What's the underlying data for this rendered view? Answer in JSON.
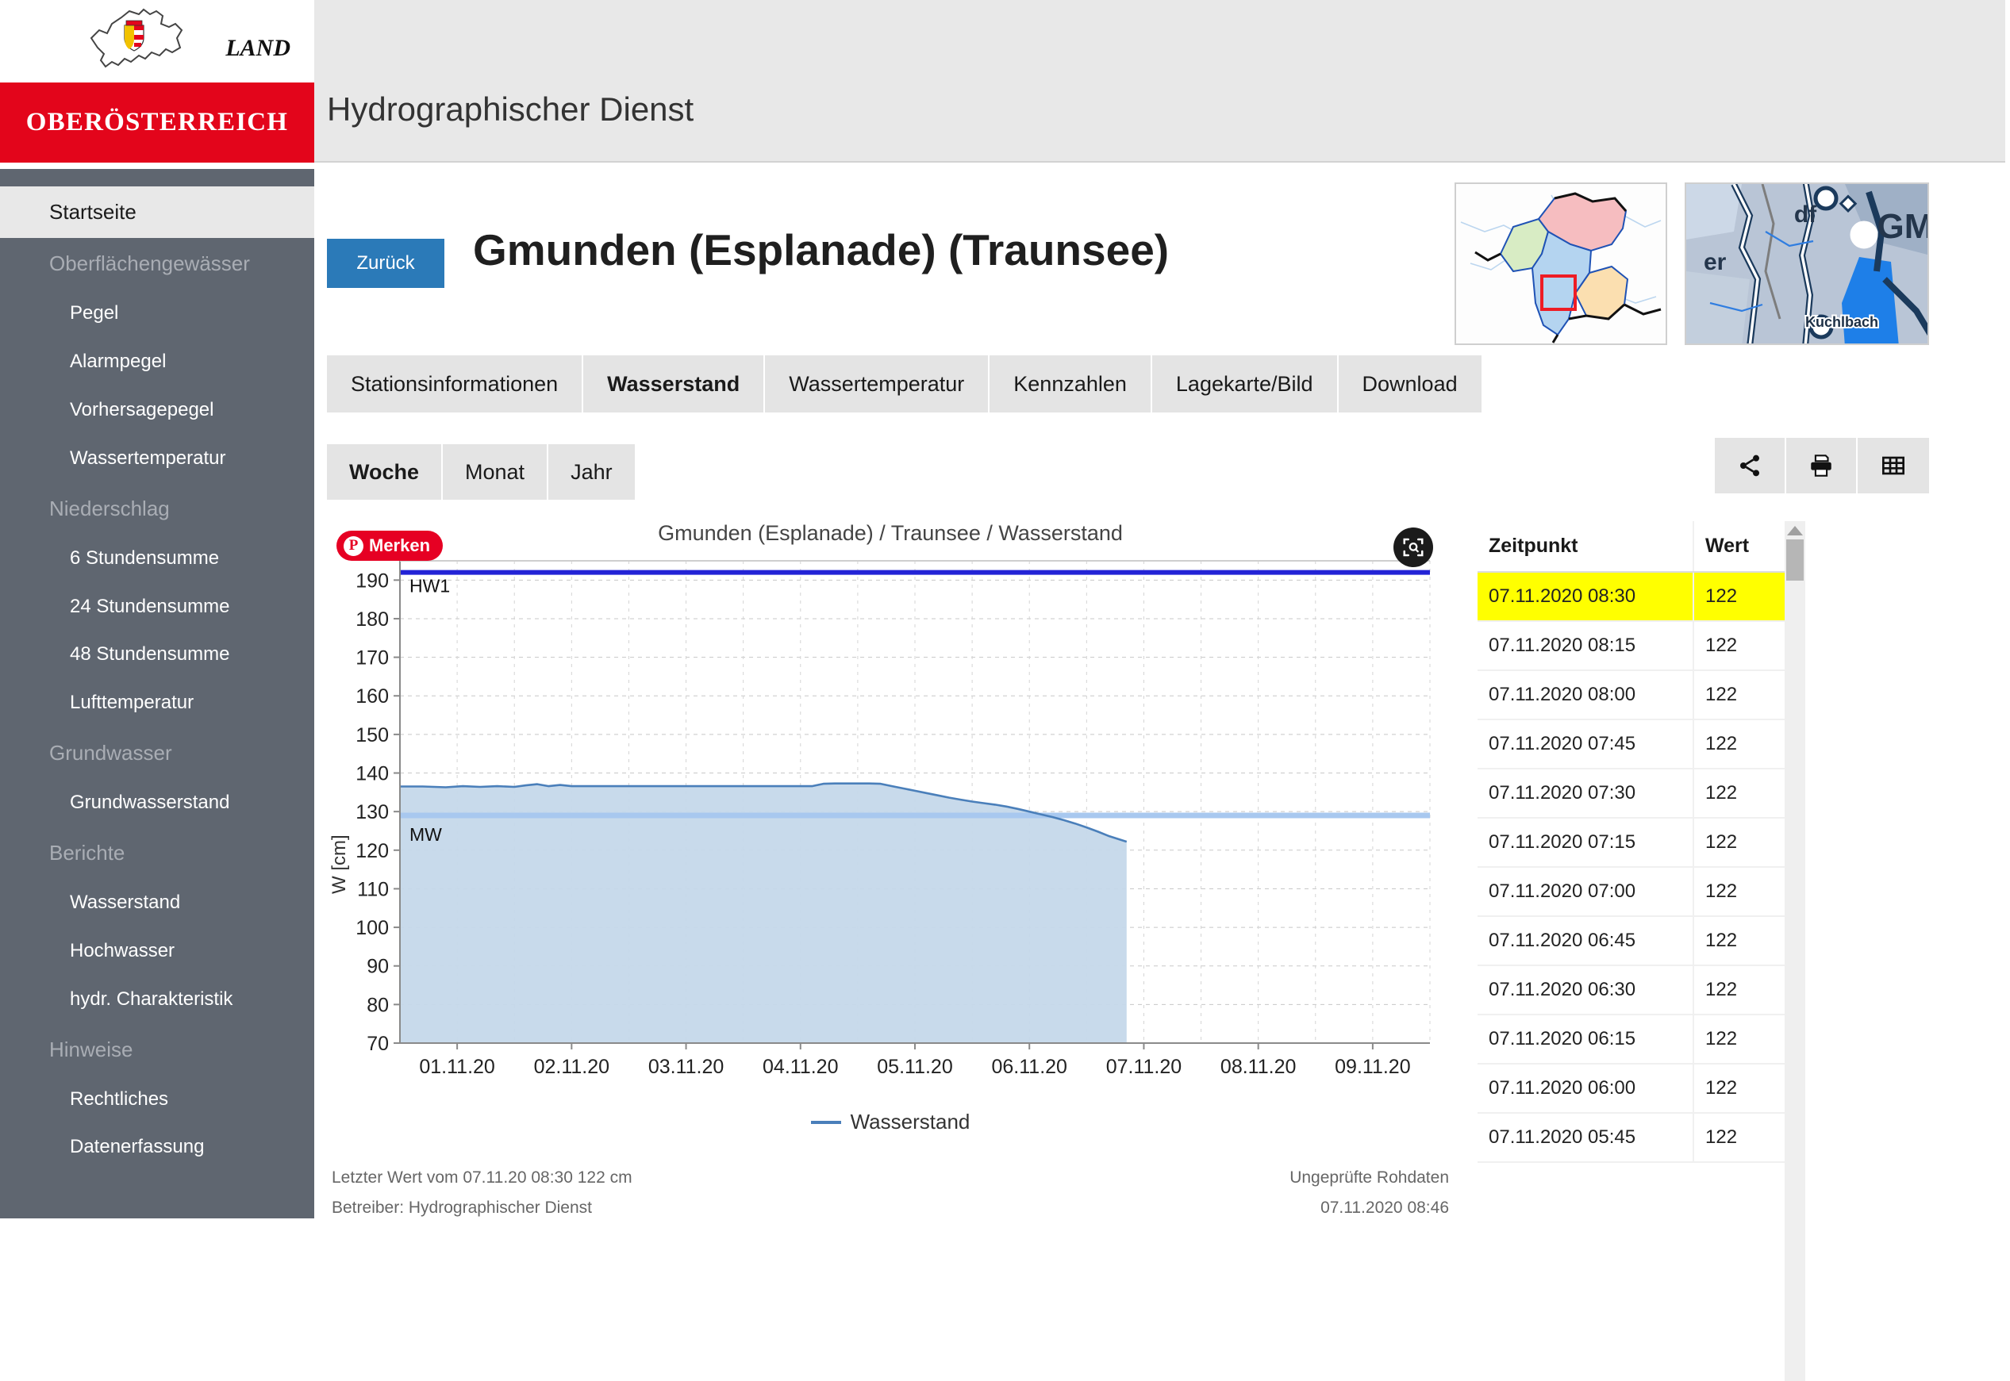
{
  "brand": {
    "land_label": "LAND",
    "state_label": "OBERÖSTERREICH"
  },
  "header": {
    "title": "Hydrographischer Dienst"
  },
  "sidebar": {
    "home_label": "Startseite",
    "entries": [
      {
        "type": "group",
        "label": "Oberflächengewässer"
      },
      {
        "type": "item",
        "label": "Pegel"
      },
      {
        "type": "item",
        "label": "Alarmpegel"
      },
      {
        "type": "item",
        "label": "Vorhersagepegel"
      },
      {
        "type": "item",
        "label": "Wassertemperatur"
      },
      {
        "type": "group",
        "label": "Niederschlag"
      },
      {
        "type": "item",
        "label": "6 Stundensumme"
      },
      {
        "type": "item",
        "label": "24 Stundensumme"
      },
      {
        "type": "item",
        "label": "48 Stundensumme"
      },
      {
        "type": "item",
        "label": "Lufttemperatur"
      },
      {
        "type": "group",
        "label": "Grundwasser"
      },
      {
        "type": "item",
        "label": "Grundwasserstand"
      },
      {
        "type": "group",
        "label": "Berichte"
      },
      {
        "type": "item",
        "label": "Wasserstand"
      },
      {
        "type": "item",
        "label": "Hochwasser"
      },
      {
        "type": "item",
        "label": "hydr. Charakteristik"
      },
      {
        "type": "group",
        "label": "Hinweise"
      },
      {
        "type": "item",
        "label": "Rechtliches"
      },
      {
        "type": "item",
        "label": "Datenerfassung"
      }
    ]
  },
  "page": {
    "back_label": "Zurück",
    "title": "Gmunden (Esplanade) (Traunsee)"
  },
  "tabs": [
    {
      "label": "Stationsinformationen",
      "active": false
    },
    {
      "label": "Wasserstand",
      "active": true
    },
    {
      "label": "Wassertemperatur",
      "active": false
    },
    {
      "label": "Kennzahlen",
      "active": false
    },
    {
      "label": "Lagekarte/Bild",
      "active": false
    },
    {
      "label": "Download",
      "active": false
    }
  ],
  "periods": [
    {
      "label": "Woche",
      "active": true
    },
    {
      "label": "Monat",
      "active": false
    },
    {
      "label": "Jahr",
      "active": false
    }
  ],
  "toolbar": {
    "share_label": "share-icon",
    "print_label": "print-icon",
    "table_label": "table-icon"
  },
  "chart_overlays": {
    "pin_label": "Merken",
    "pin_glyph": "P",
    "zoom_label": "zoom-icon"
  },
  "chart_data": {
    "type": "area",
    "title": "Gmunden (Esplanade) / Traunsee / Wasserstand",
    "xlabel": "",
    "ylabel": "W [cm]",
    "ylim": [
      70,
      195
    ],
    "yticks": [
      70,
      80,
      90,
      100,
      110,
      120,
      130,
      140,
      150,
      160,
      170,
      180,
      190
    ],
    "xticks": [
      "01.11.20",
      "02.11.20",
      "03.11.20",
      "04.11.20",
      "05.11.20",
      "06.11.20",
      "07.11.20",
      "08.11.20",
      "09.11.20"
    ],
    "grid": true,
    "legend": [
      {
        "name": "Wasserstand",
        "color": "#4a7fba"
      }
    ],
    "legend_position": "bottom",
    "reference_lines": [
      {
        "label": "HW1",
        "value": 192,
        "color": "#2323d6"
      },
      {
        "label": "MW",
        "value": 129,
        "color": "#a8c8ef"
      }
    ],
    "series": [
      {
        "name": "Wasserstand",
        "color": "#4a7fba",
        "fill": "#c5d8ea",
        "x": [
          0.0,
          0.2,
          0.4,
          0.55,
          0.7,
          0.85,
          1.0,
          1.1,
          1.2,
          1.3,
          1.4,
          1.5,
          1.7,
          1.9,
          2.2,
          2.5,
          2.8,
          3.1,
          3.4,
          3.6,
          3.7,
          3.8,
          3.9,
          4.0,
          4.1,
          4.2,
          4.3,
          4.4,
          4.5,
          4.6,
          4.7,
          4.8,
          4.9,
          5.0,
          5.1,
          5.2,
          5.3,
          5.4,
          5.5,
          5.6,
          5.7,
          5.8,
          5.9,
          6.0,
          6.1,
          6.2,
          6.35
        ],
        "y": [
          136.5,
          136.5,
          136.3,
          136.6,
          136.4,
          136.6,
          136.4,
          136.8,
          137.1,
          136.6,
          136.9,
          136.6,
          136.6,
          136.6,
          136.6,
          136.6,
          136.6,
          136.6,
          136.6,
          136.6,
          137.2,
          137.3,
          137.3,
          137.3,
          137.3,
          137.2,
          136.6,
          136.0,
          135.4,
          134.8,
          134.2,
          133.6,
          133.1,
          132.6,
          132.2,
          131.8,
          131.3,
          130.7,
          130.0,
          129.3,
          128.6,
          127.8,
          126.9,
          125.9,
          124.8,
          123.6,
          122.2
        ]
      }
    ],
    "x_range_days": 9,
    "unit": "cm"
  },
  "chart_footer": {
    "left_1": "Letzter Wert vom 07.11.20 08:30 122 cm",
    "left_2": "Betreiber: Hydrographischer Dienst",
    "right_1": "Ungeprüfte Rohdaten",
    "right_2": "07.11.2020 08:46"
  },
  "table": {
    "columns": [
      "Zeitpunkt",
      "Wert"
    ],
    "rows": [
      {
        "time": "07.11.2020 08:30",
        "value": "122",
        "highlight": true
      },
      {
        "time": "07.11.2020 08:15",
        "value": "122",
        "highlight": false
      },
      {
        "time": "07.11.2020 08:00",
        "value": "122",
        "highlight": false
      },
      {
        "time": "07.11.2020 07:45",
        "value": "122",
        "highlight": false
      },
      {
        "time": "07.11.2020 07:30",
        "value": "122",
        "highlight": false
      },
      {
        "time": "07.11.2020 07:15",
        "value": "122",
        "highlight": false
      },
      {
        "time": "07.11.2020 07:00",
        "value": "122",
        "highlight": false
      },
      {
        "time": "07.11.2020 06:45",
        "value": "122",
        "highlight": false
      },
      {
        "time": "07.11.2020 06:30",
        "value": "122",
        "highlight": false
      },
      {
        "time": "07.11.2020 06:15",
        "value": "122",
        "highlight": false
      },
      {
        "time": "07.11.2020 06:00",
        "value": "122",
        "highlight": false
      },
      {
        "time": "07.11.2020 05:45",
        "value": "122",
        "highlight": false
      }
    ]
  },
  "maps": {
    "overview_label": "upper-austria-overview-map",
    "detail_label": "station-detail-map",
    "detail_water_label": "Kuchlbach",
    "detail_place_label": "GM",
    "detail_place_label_2": "df",
    "detail_place_label_3": "er"
  },
  "colors": {
    "brand_red": "#e3051b",
    "sidebar": "#5f6670",
    "accent_blue": "#2b7ab8",
    "series": "#4a7fba",
    "fill": "#c5d8ea",
    "hw1": "#2323d6",
    "mw": "#a8c8ef",
    "highlight": "#ffff00",
    "pinterest": "#e60023"
  }
}
